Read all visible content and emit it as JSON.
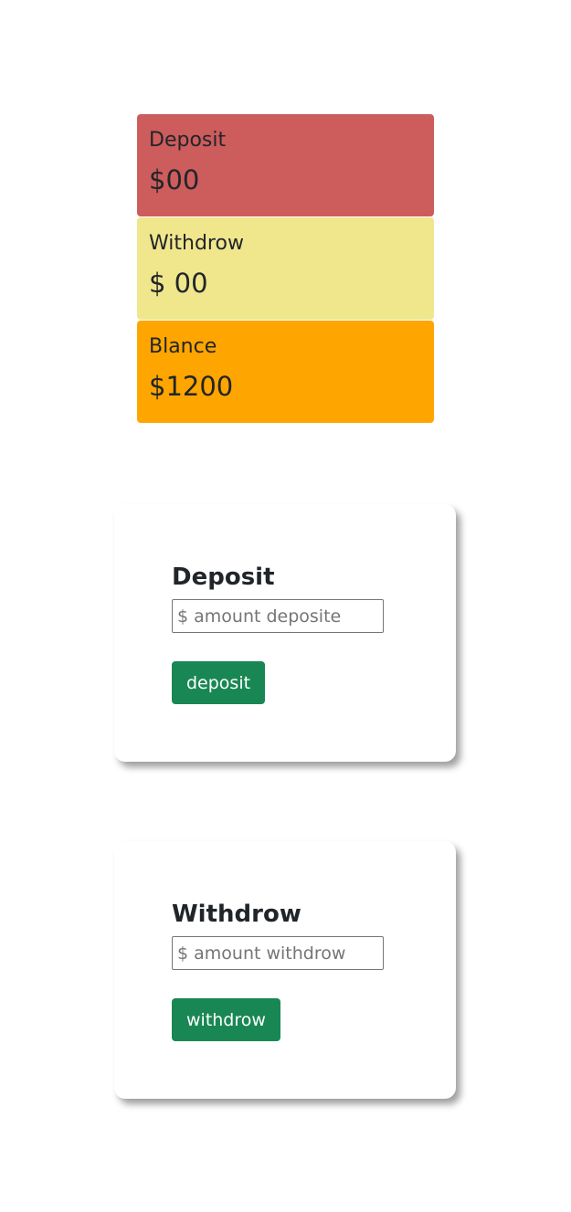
{
  "summary": {
    "deposit": {
      "label": "Deposit",
      "amount": "$00",
      "color": "#cd5c5c"
    },
    "withdraw": {
      "label": "Withdrow",
      "amount": "$ 00",
      "color": "#f0e68c"
    },
    "balance": {
      "label": "Blance",
      "amount": "$1200",
      "color": "#ffa500"
    }
  },
  "deposit_form": {
    "title": "Deposit",
    "placeholder": "$ amount deposite",
    "button_label": "deposit"
  },
  "withdraw_form": {
    "title": "Withdrow",
    "placeholder": "$ amount withdrow",
    "button_label": "withdrow"
  },
  "colors": {
    "button": "#198754"
  }
}
